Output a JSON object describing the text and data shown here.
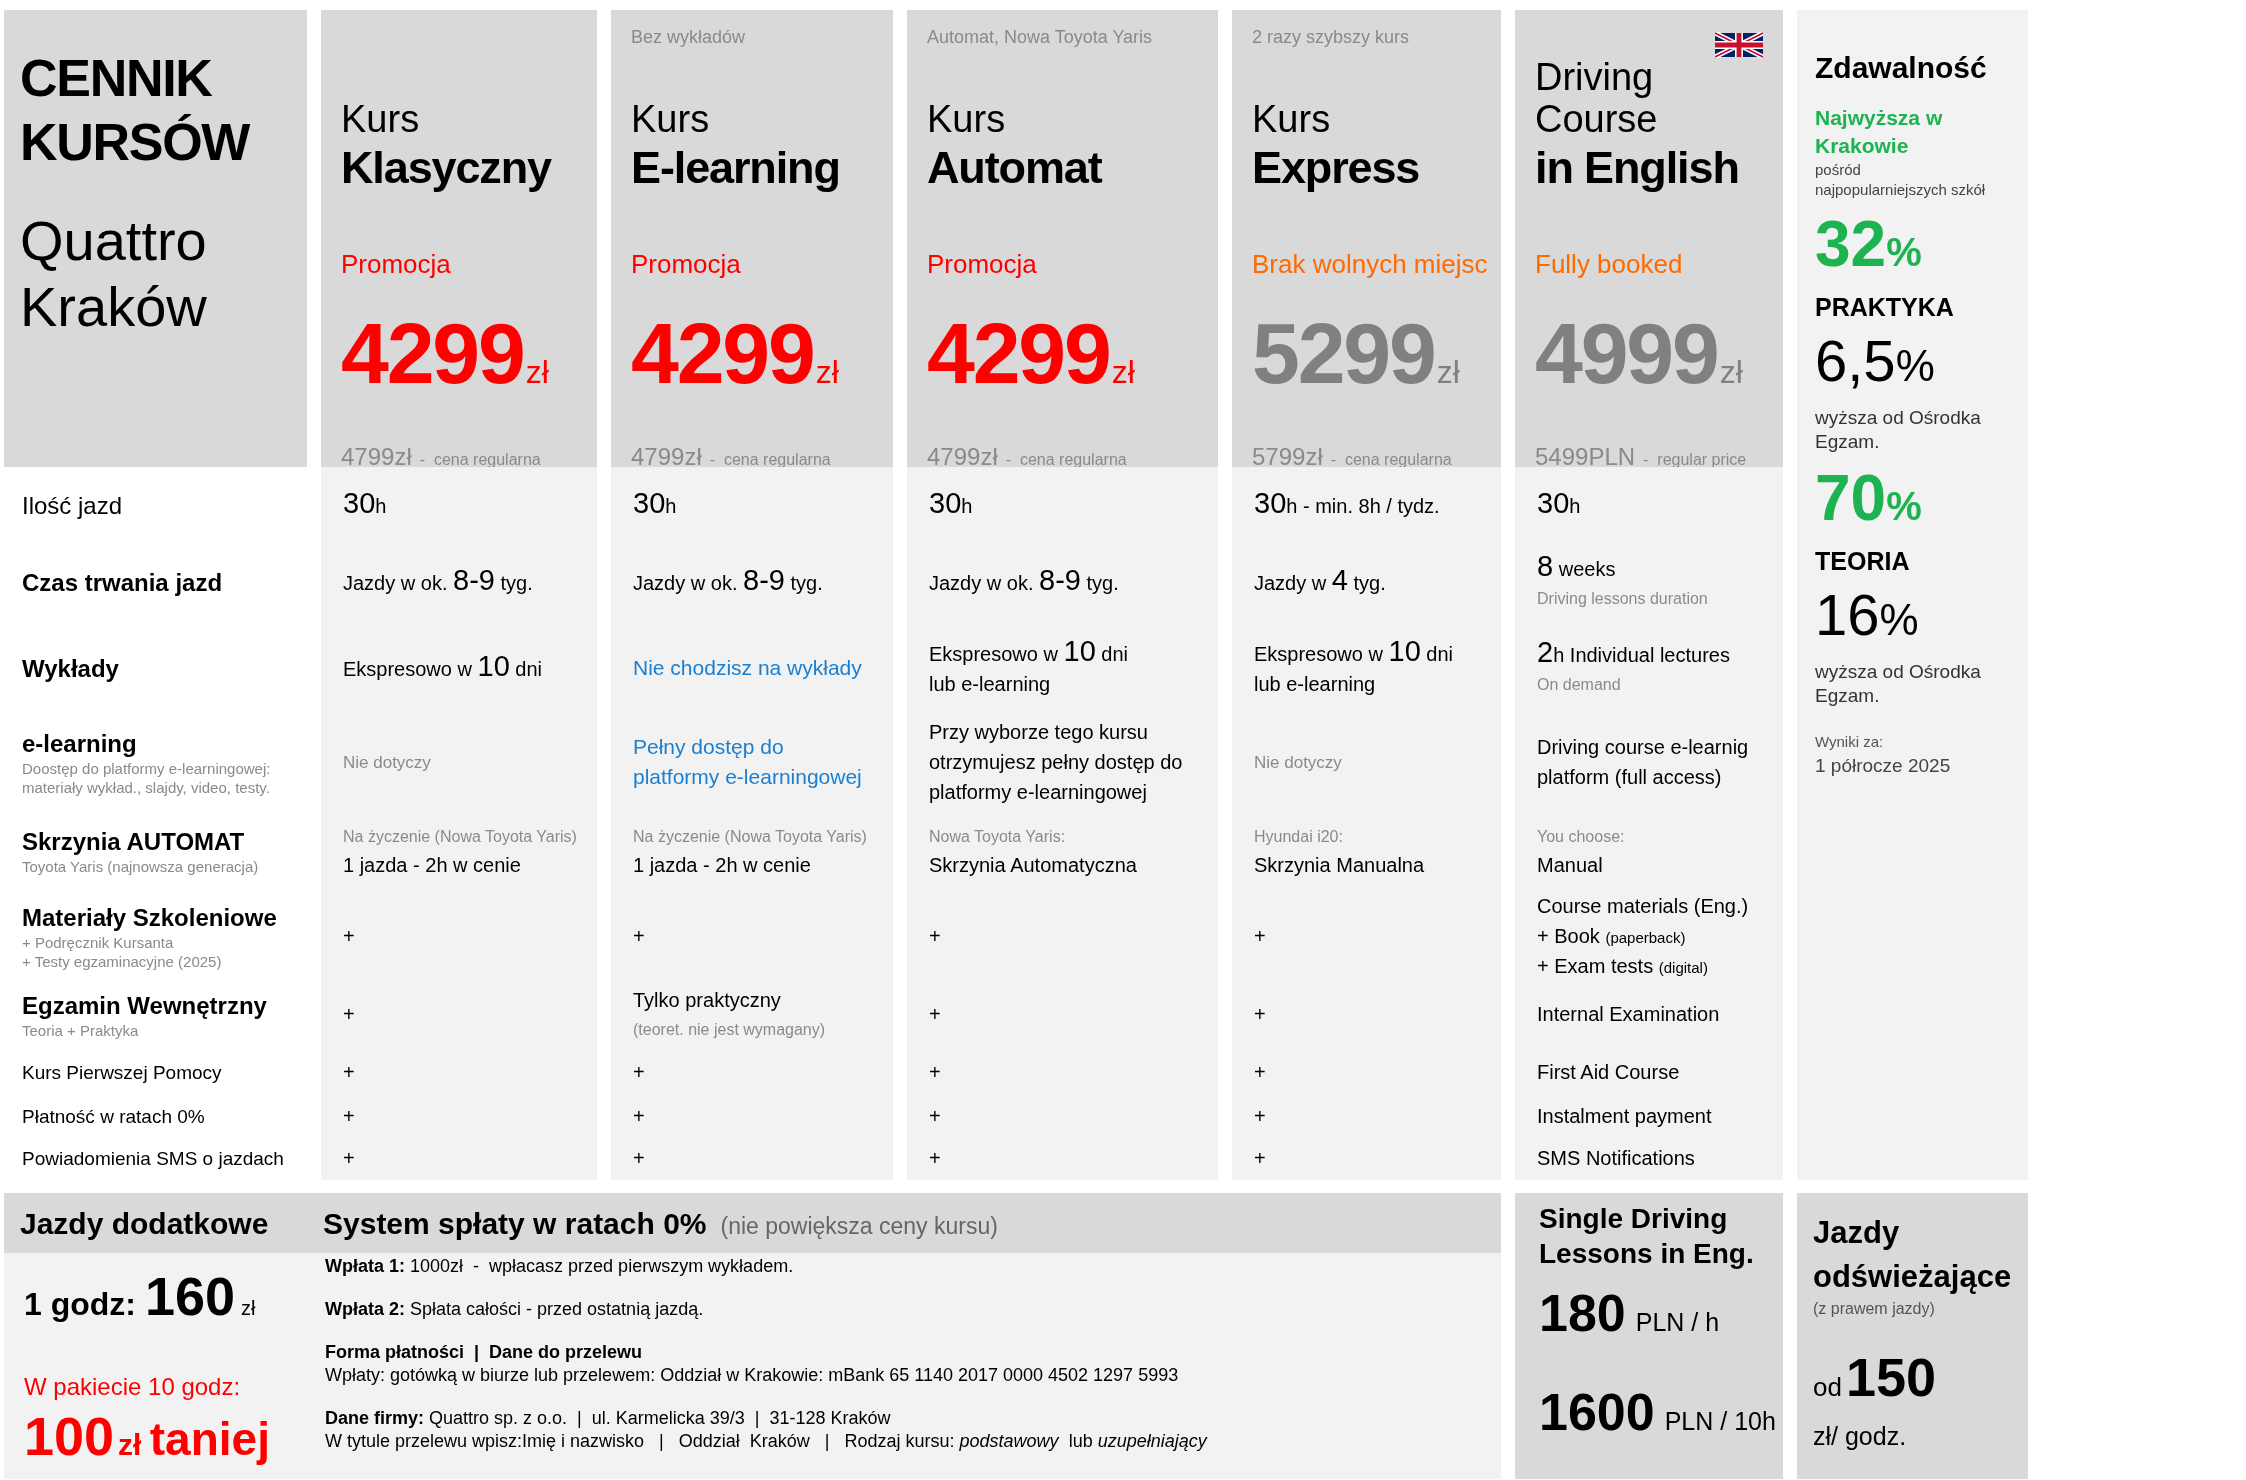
{
  "heading": {
    "title": "CENNIK KURSÓW",
    "subtitle": "Quattro Kraków"
  },
  "courses": [
    {
      "prefix": "Kurs",
      "name": "Klasyczny",
      "status": "Promocja",
      "kind": "promo",
      "price": "4299",
      "currency": "zł",
      "regular_price": "4799zł",
      "regular_note": "-  cena regularna",
      "flag_icon": false
    },
    {
      "subtitle": "Bez wykładów",
      "prefix": "Kurs",
      "name": "E-learning",
      "status": "Promocja",
      "kind": "promo",
      "price": "4299",
      "currency": "zł",
      "regular_price": "4799zł",
      "regular_note": "-  cena regularna",
      "flag_icon": false
    },
    {
      "subtitle": "Automat, Nowa Toyota Yaris",
      "prefix": "Kurs",
      "name": "Automat",
      "status": "Promocja",
      "kind": "promo",
      "price": "4299",
      "currency": "zł",
      "regular_price": "4799zł",
      "regular_note": "-  cena regularna",
      "flag_icon": false
    },
    {
      "subtitle": "2 razy szybszy kurs",
      "prefix": "Kurs",
      "name": "Express",
      "status": "Brak wolnych miejsc",
      "kind": "full",
      "price": "5299",
      "currency": "zł",
      "regular_price": "5799zł",
      "regular_note": "-  cena regularna",
      "flag_icon": false
    },
    {
      "prefix": "Driving\nCourse",
      "name": "in English",
      "status": "Fully booked",
      "kind": "full",
      "price": "4999",
      "currency": "zł",
      "regular_price": "5499PLN",
      "regular_note": "-  regular price",
      "flag_icon": true
    }
  ],
  "rows": [
    {
      "label": {
        "title": "Ilość jazd",
        "kind": "plain"
      },
      "cells": [
        [
          [
            {
              "kind": "big",
              "text": "30"
            },
            {
              "kind": "text",
              "text": "h"
            }
          ]
        ],
        [
          [
            {
              "kind": "big",
              "text": "30"
            },
            {
              "kind": "text",
              "text": "h"
            }
          ]
        ],
        [
          [
            {
              "kind": "big",
              "text": "30"
            },
            {
              "kind": "text",
              "text": "h"
            }
          ]
        ],
        [
          [
            {
              "kind": "big",
              "text": "30"
            },
            {
              "kind": "text",
              "text": "h  - min. 8h / tydz."
            }
          ]
        ],
        [
          [
            {
              "kind": "big",
              "text": "30"
            },
            {
              "kind": "text",
              "text": "h"
            }
          ]
        ]
      ]
    },
    {
      "label": {
        "title": "Czas trwania jazd",
        "kind": "bold"
      },
      "cells": [
        [
          [
            {
              "kind": "text",
              "text": "Jazdy w ok. "
            },
            {
              "kind": "big",
              "text": "8-9"
            },
            {
              "kind": "text",
              "text": " tyg."
            }
          ]
        ],
        [
          [
            {
              "kind": "text",
              "text": "Jazdy w ok. "
            },
            {
              "kind": "big",
              "text": "8-9"
            },
            {
              "kind": "text",
              "text": " tyg."
            }
          ]
        ],
        [
          [
            {
              "kind": "text",
              "text": "Jazdy w ok. "
            },
            {
              "kind": "big",
              "text": "8-9"
            },
            {
              "kind": "text",
              "text": " tyg."
            }
          ]
        ],
        [
          [
            {
              "kind": "text",
              "text": "Jazdy w "
            },
            {
              "kind": "big",
              "text": "4"
            },
            {
              "kind": "text",
              "text": " tyg."
            }
          ]
        ],
        [
          [
            {
              "kind": "big",
              "text": "8"
            },
            {
              "kind": "text",
              "text": " weeks"
            }
          ],
          [
            {
              "kind": "note",
              "text": "Driving lessons duration"
            }
          ]
        ]
      ]
    },
    {
      "label": {
        "title": "Wykłady",
        "kind": "bold"
      },
      "cells": [
        [
          [
            {
              "kind": "text",
              "text": "Ekspresowo w "
            },
            {
              "kind": "big",
              "text": "10"
            },
            {
              "kind": "text",
              "text": " dni"
            }
          ]
        ],
        [
          [
            {
              "kind": "blue",
              "text": "Nie chodzisz na wykłady"
            }
          ]
        ],
        [
          [
            {
              "kind": "text",
              "text": "Ekspresowo w "
            },
            {
              "kind": "big",
              "text": "10"
            },
            {
              "kind": "text",
              "text": " dni\nlub e-learning"
            }
          ]
        ],
        [
          [
            {
              "kind": "text",
              "text": "Ekspresowo w "
            },
            {
              "kind": "big",
              "text": "10"
            },
            {
              "kind": "text",
              "text": " dni\nlub e-learning"
            }
          ]
        ],
        [
          [
            {
              "kind": "big",
              "text": "2"
            },
            {
              "kind": "text",
              "text": "h Individual lectures"
            }
          ],
          [
            {
              "kind": "note",
              "text": "On demand"
            }
          ]
        ]
      ]
    },
    {
      "label": {
        "title": "e-learning",
        "kind": "bold",
        "note": "Doostęp do platformy e-learningowej:\nmateriały wykład., slajdy, video, testy."
      },
      "cells": [
        [
          [
            {
              "kind": "muted",
              "text": "Nie dotyczy"
            }
          ]
        ],
        [
          [
            {
              "kind": "blue",
              "text": "Pełny dostęp do\nplatformy e-learningowej"
            }
          ]
        ],
        [
          [
            {
              "kind": "text",
              "text": "Przy wyborze tego kursu\notrzymujesz pełny dostęp do\nplatformy e-learningowej"
            }
          ]
        ],
        [
          [
            {
              "kind": "muted",
              "text": "Nie dotyczy"
            }
          ]
        ],
        [
          [
            {
              "kind": "text",
              "text": "Driving course e-learnig\nplatform (full access)"
            }
          ]
        ]
      ]
    },
    {
      "label": {
        "title": "Skrzynia AUTOMAT",
        "kind": "bold",
        "note": "Toyota Yaris (najnowsza generacja)"
      },
      "cells": [
        [
          [
            {
              "kind": "note",
              "text": "Na życzenie (Nowa Toyota Yaris)"
            }
          ],
          [
            {
              "kind": "text",
              "text": "1 jazda - 2h w cenie"
            }
          ]
        ],
        [
          [
            {
              "kind": "note",
              "text": "Na życzenie (Nowa Toyota Yaris)"
            }
          ],
          [
            {
              "kind": "text",
              "text": "1 jazda - 2h w cenie"
            }
          ]
        ],
        [
          [
            {
              "kind": "note",
              "text": "Nowa Toyota Yaris:"
            }
          ],
          [
            {
              "kind": "text",
              "text": "Skrzynia Automatyczna"
            }
          ]
        ],
        [
          [
            {
              "kind": "note",
              "text": "Hyundai i20:"
            }
          ],
          [
            {
              "kind": "text",
              "text": "Skrzynia Manualna"
            }
          ]
        ],
        [
          [
            {
              "kind": "note",
              "text": "You choose:"
            }
          ],
          [
            {
              "kind": "text",
              "text": "Manual"
            }
          ]
        ]
      ]
    },
    {
      "label": {
        "title": "Materiały Szkoleniowe",
        "kind": "bold",
        "note": "+ Podręcznik Kursanta\n+ Testy egzaminacyjne (2025)"
      },
      "cells": [
        [
          [
            {
              "kind": "text",
              "text": "+"
            }
          ]
        ],
        [
          [
            {
              "kind": "text",
              "text": "+"
            }
          ]
        ],
        [
          [
            {
              "kind": "text",
              "text": "+"
            }
          ]
        ],
        [
          [
            {
              "kind": "text",
              "text": "+"
            }
          ]
        ],
        [
          [
            {
              "kind": "text",
              "text": "Course materials (Eng.)\n+ Book "
            },
            {
              "kind": "small",
              "text": "(paperback)"
            },
            {
              "kind": "text",
              "text": "\n+ Exam tests "
            },
            {
              "kind": "small",
              "text": "(digital)"
            }
          ]
        ]
      ]
    },
    {
      "label": {
        "title": "Egzamin Wewnętrzny",
        "kind": "bold",
        "note": "Teoria + Praktyka"
      },
      "cells": [
        [
          [
            {
              "kind": "text",
              "text": "+"
            }
          ]
        ],
        [
          [
            {
              "kind": "text",
              "text": "Tylko praktyczny"
            }
          ],
          [
            {
              "kind": "note",
              "text": "(teoret. nie jest wymagany)"
            }
          ]
        ],
        [
          [
            {
              "kind": "text",
              "text": "+"
            }
          ]
        ],
        [
          [
            {
              "kind": "text",
              "text": "+"
            }
          ]
        ],
        [
          [
            {
              "kind": "text",
              "text": "Internal Examination"
            }
          ]
        ]
      ]
    },
    {
      "label": {
        "title": "Kurs Pierwszej Pomocy",
        "kind": "small"
      },
      "cells": [
        [
          [
            {
              "kind": "text",
              "text": "+"
            }
          ]
        ],
        [
          [
            {
              "kind": "text",
              "text": "+"
            }
          ]
        ],
        [
          [
            {
              "kind": "text",
              "text": "+"
            }
          ]
        ],
        [
          [
            {
              "kind": "text",
              "text": "+"
            }
          ]
        ],
        [
          [
            {
              "kind": "text",
              "text": "First Aid Course"
            }
          ]
        ]
      ]
    },
    {
      "label": {
        "title": "Płatność w ratach 0%",
        "kind": "small"
      },
      "cells": [
        [
          [
            {
              "kind": "text",
              "text": "+"
            }
          ]
        ],
        [
          [
            {
              "kind": "text",
              "text": "+"
            }
          ]
        ],
        [
          [
            {
              "kind": "text",
              "text": "+"
            }
          ]
        ],
        [
          [
            {
              "kind": "text",
              "text": "+"
            }
          ]
        ],
        [
          [
            {
              "kind": "text",
              "text": "Instalment payment"
            }
          ]
        ]
      ]
    },
    {
      "label": {
        "title": "Powiadomienia SMS o jazdach",
        "kind": "small"
      },
      "cells": [
        [
          [
            {
              "kind": "text",
              "text": "+"
            }
          ]
        ],
        [
          [
            {
              "kind": "text",
              "text": "+"
            }
          ]
        ],
        [
          [
            {
              "kind": "text",
              "text": "+"
            }
          ]
        ],
        [
          [
            {
              "kind": "text",
              "text": "+"
            }
          ]
        ],
        [
          [
            {
              "kind": "text",
              "text": "SMS Notifications"
            }
          ]
        ]
      ]
    }
  ],
  "pass_rates": [
    {
      "kind": "heading",
      "text": "Zdawalność"
    },
    {
      "kind": "highlight",
      "text": "Najwyższa w\nKrakowie"
    },
    {
      "kind": "note",
      "text": "pośród\nnajpopularniejszych szkół"
    },
    {
      "kind": "pass_rate",
      "value": "32",
      "unit": "%"
    },
    {
      "kind": "category",
      "text": "PRAKTYKA"
    },
    {
      "kind": "difference",
      "value": "6,5",
      "unit": "%"
    },
    {
      "kind": "caption",
      "text": "wyższa od Ośrodka\nEgzam."
    },
    {
      "kind": "pass_rate",
      "value": "70",
      "unit": "%"
    },
    {
      "kind": "category",
      "text": "TEORIA"
    },
    {
      "kind": "difference",
      "value": "16",
      "unit": "%"
    },
    {
      "kind": "caption",
      "text": "wyższa od Ośrodka\nEgzam."
    },
    {
      "kind": "results_label",
      "text": "Wyniki za:"
    },
    {
      "kind": "period",
      "text": "1 półrocze 2025"
    }
  ],
  "extra_lessons": {
    "title": "Jazdy dodatkowe",
    "price_label": "1 godz:",
    "price": "160",
    "currency": "zł",
    "package_label": "W pakiecie 10 godz:",
    "discount": "100",
    "discount_currency": "zł",
    "discount_word": "taniej"
  },
  "installments": {
    "title": "System spłaty w ratach 0%",
    "note": "(nie powiększa ceny kursu)",
    "paragraphs": [
      [
        {
          "kind": "text",
          "text": "**Wpłata 1:** 1000zł  -  wpłacasz przed pierwszym wykładem."
        }
      ],
      [
        {
          "kind": "text",
          "text": "**Wpłata 2:** Spłata całości - przed ostatnią jazdą."
        }
      ],
      [
        {
          "kind": "heading",
          "text": "Forma płatności  |  Dane do przelewu"
        },
        {
          "kind": "text",
          "text": "Wpłaty: gotówką w biurze lub przelewem: Oddział w Krakowie: mBank 65 1140 2017 0000 4502 1297 5993"
        }
      ],
      [
        {
          "kind": "text",
          "text": "**Dane firmy:** Quattro sp. z o.o.  |  ul. Karmelicka 39/3  |  31-128 Kraków"
        },
        {
          "kind": "text",
          "text": "W tytule przelewu wpisz:Imię i nazwisko   |   Oddział  Kraków   |   Rodzaj kursu: *podstawowy*  lub *uzupełniający*"
        }
      ]
    ]
  },
  "english_lessons": {
    "title": "Single Driving\nLessons in Eng.",
    "prices": [
      {
        "amount": "180",
        "unit": "PLN / h"
      },
      {
        "amount": "1600",
        "unit": "PLN / 10h"
      }
    ]
  },
  "refresher": {
    "title": "Jazdy\nodświeżające",
    "note": "(z prawem jazdy)",
    "prefix": "od",
    "price": "150",
    "unit": "zł/ godz."
  }
}
